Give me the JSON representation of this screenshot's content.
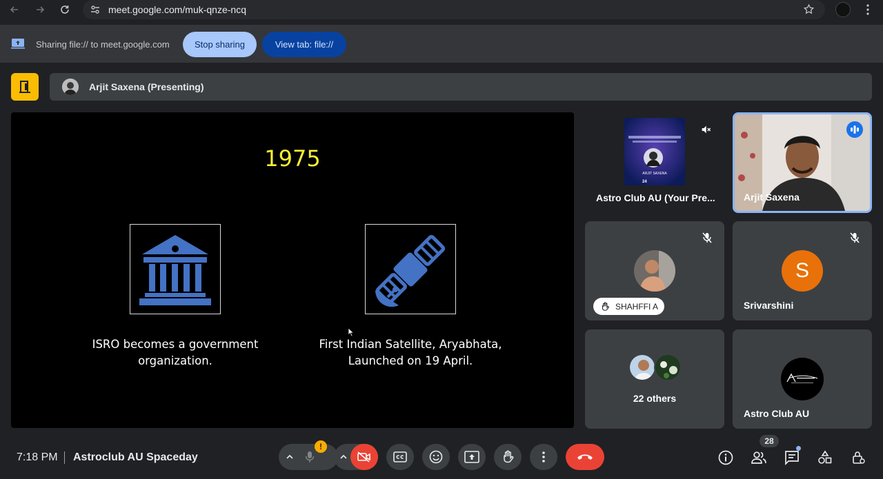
{
  "browser": {
    "url": "meet.google.com/muk-qnze-ncq"
  },
  "share_bar": {
    "text": "Sharing file:// to meet.google.com",
    "stop_label": "Stop sharing",
    "view_label": "View tab: file://"
  },
  "presenter": {
    "name": "Arjit Saxena (Presenting)"
  },
  "slide": {
    "year": "1975",
    "items": [
      {
        "icon": "government-building-icon",
        "caption_line1": "ISRO becomes a government",
        "caption_line2": "organization."
      },
      {
        "icon": "satellite-icon",
        "caption_line1": "First Indian Satellite, Aryabhata,",
        "caption_line2": "Launched on 19 April."
      }
    ]
  },
  "tiles": [
    {
      "name": "Astro Club AU (Your Pre...",
      "state": "presentation-muted"
    },
    {
      "name": "Arjit Saxena",
      "state": "speaking"
    },
    {
      "name": "SHAHFFI A",
      "state": "hand-raised"
    },
    {
      "name": "Srivarshini",
      "avatar_letter": "S",
      "state": "muted"
    },
    {
      "name": "22 others"
    },
    {
      "name": "Astro Club AU"
    }
  ],
  "poster": {
    "name": "ARJIT SAXENA",
    "date": "24"
  },
  "bottom": {
    "time": "7:18 PM",
    "meeting": "Astroclub AU Spaceday",
    "people_count": "28",
    "mic_alert": "!"
  },
  "colors": {
    "accent": "#a8c7fa",
    "end_call": "#ea4335",
    "slide_year": "#f6ee35",
    "slide_icon": "#4472c4",
    "avatar_orange": "#e8710a"
  }
}
